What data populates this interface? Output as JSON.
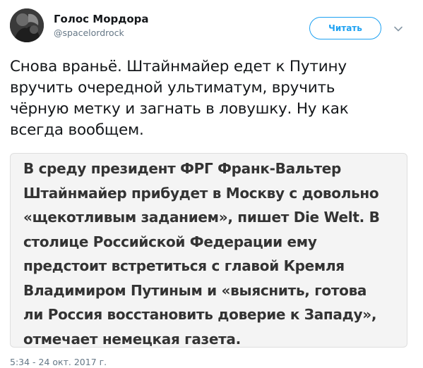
{
  "account": {
    "display_name": "Голос Мордора",
    "handle": "@spacelordrock"
  },
  "follow_button": {
    "label": "Читать"
  },
  "tweet": {
    "lines": [
      "Снова враньё. Штайнмайер едет к Путину",
      "вручить очередной ультиматум, вручить",
      "чёрную метку и загнать в ловушку. Ну как",
      "всегда вообщем."
    ]
  },
  "quoted_image": {
    "lines": [
      "В среду президент ФРГ Франк-Вальтер",
      "Штайнмайер прибудет в Москву с довольно",
      "«щекотливым заданием», пишет Die Welt. В",
      "столице Российской Федерации ему",
      "предстоит встретиться с главой Кремля",
      "Владимиром Путиным и «выяснить, готова",
      "ли Россия восстановить доверие к Западу»,",
      "отмечает немецкая газета."
    ]
  },
  "timestamp": "5:34 - 24 окт. 2017 г.",
  "icons": {
    "avatar": "avatar-photo",
    "caret": "chevron-down-icon"
  },
  "colors": {
    "accent": "#1da1f2",
    "text_primary": "#14171a",
    "text_secondary": "#657786",
    "quote_bg": "#f4f4f4"
  }
}
